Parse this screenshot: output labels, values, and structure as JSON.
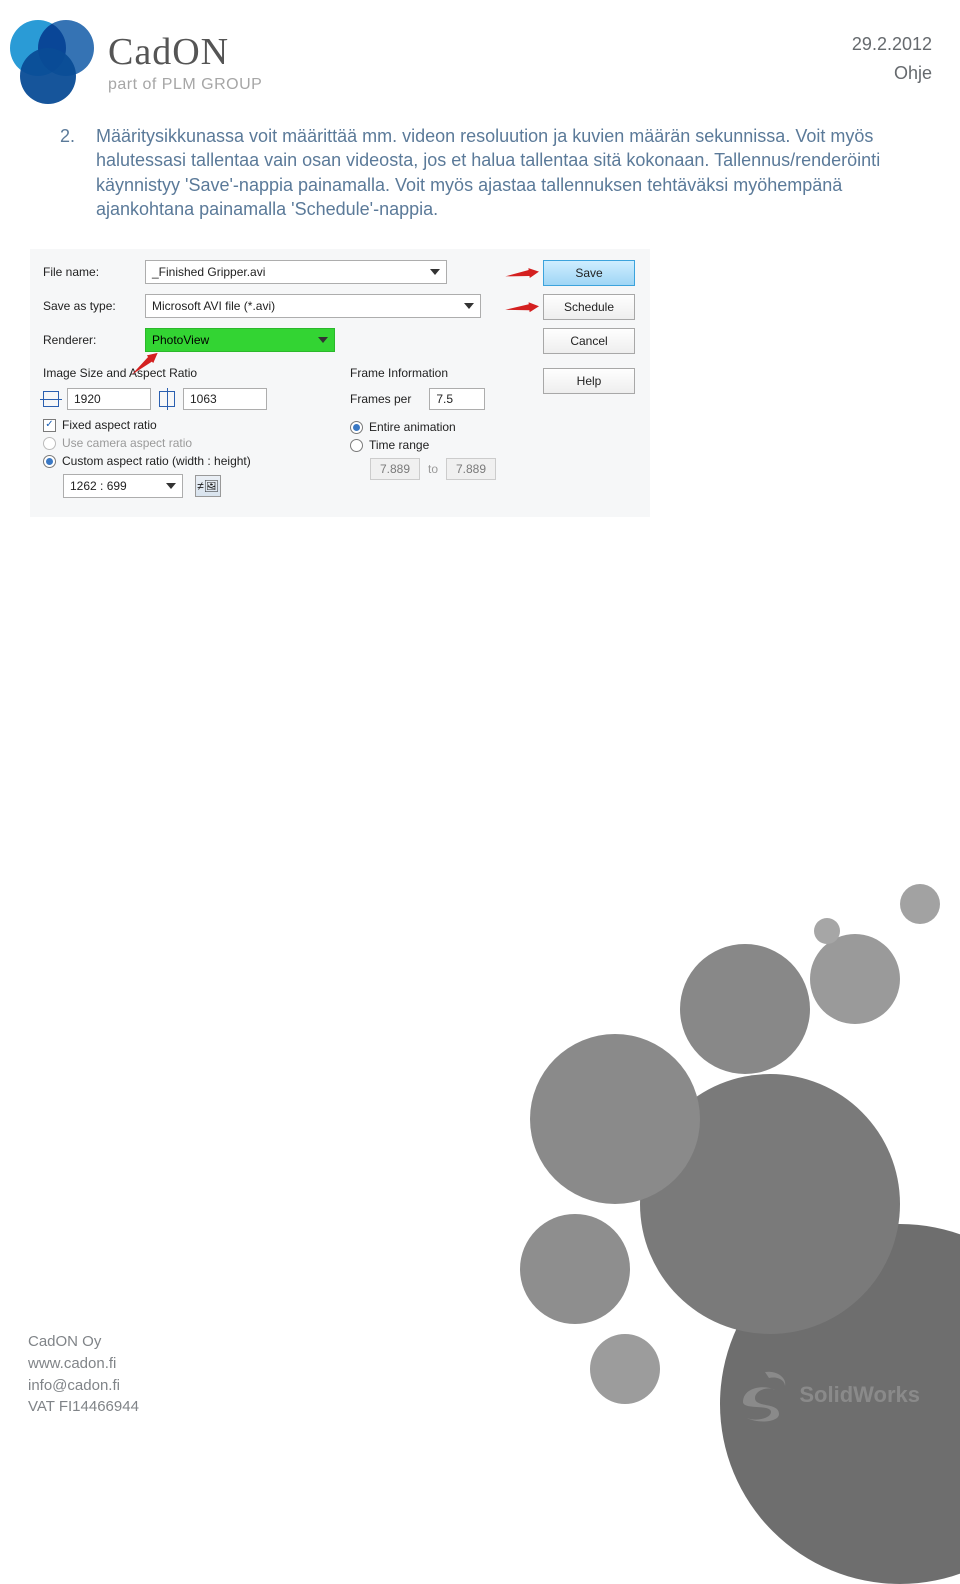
{
  "header": {
    "brand": "CadON",
    "tagline": "part of PLM GROUP",
    "date": "29.2.2012",
    "doc_type": "Ohje"
  },
  "instruction": {
    "number": "2.",
    "text": "Määritysikkunassa voit määrittää mm. videon resoluution ja kuvien määrän sekunnissa. Voit myös halutessasi tallentaa vain osan videosta, jos et halua tallentaa sitä kokonaan. Tallennus/renderöinti käynnistyy 'Save'-nappia painamalla. Voit myös ajastaa tallennuksen tehtäväksi myöhempänä ajankohtana painamalla 'Schedule'-nappia."
  },
  "dialog": {
    "labels": {
      "filename": "File name:",
      "save_as_type": "Save as type:",
      "renderer": "Renderer:",
      "image_section": "Image Size and Aspect Ratio",
      "frame_section": "Frame Information",
      "frames_per": "Frames per",
      "fixed_aspect": "Fixed aspect ratio",
      "use_camera": "Use camera aspect ratio",
      "custom_aspect": "Custom aspect ratio (width : height)",
      "entire_anim": "Entire animation",
      "time_range": "Time range",
      "to": "to"
    },
    "values": {
      "filename": "_Finished Gripper.avi",
      "save_as_type": "Microsoft AVI file (*.avi)",
      "renderer": "PhotoView",
      "width": "1920",
      "height": "1063",
      "frames_per": "7.5",
      "ratio": "1262 : 699",
      "time_from": "7.889",
      "time_to": "7.889"
    },
    "buttons": {
      "save": "Save",
      "schedule": "Schedule",
      "cancel": "Cancel",
      "help": "Help"
    }
  },
  "footer": {
    "company": "CadON Oy",
    "web": "www.cadon.fi",
    "email": "info@cadon.fi",
    "vat": "VAT FI14466944",
    "solidworks": "SolidWorks"
  }
}
